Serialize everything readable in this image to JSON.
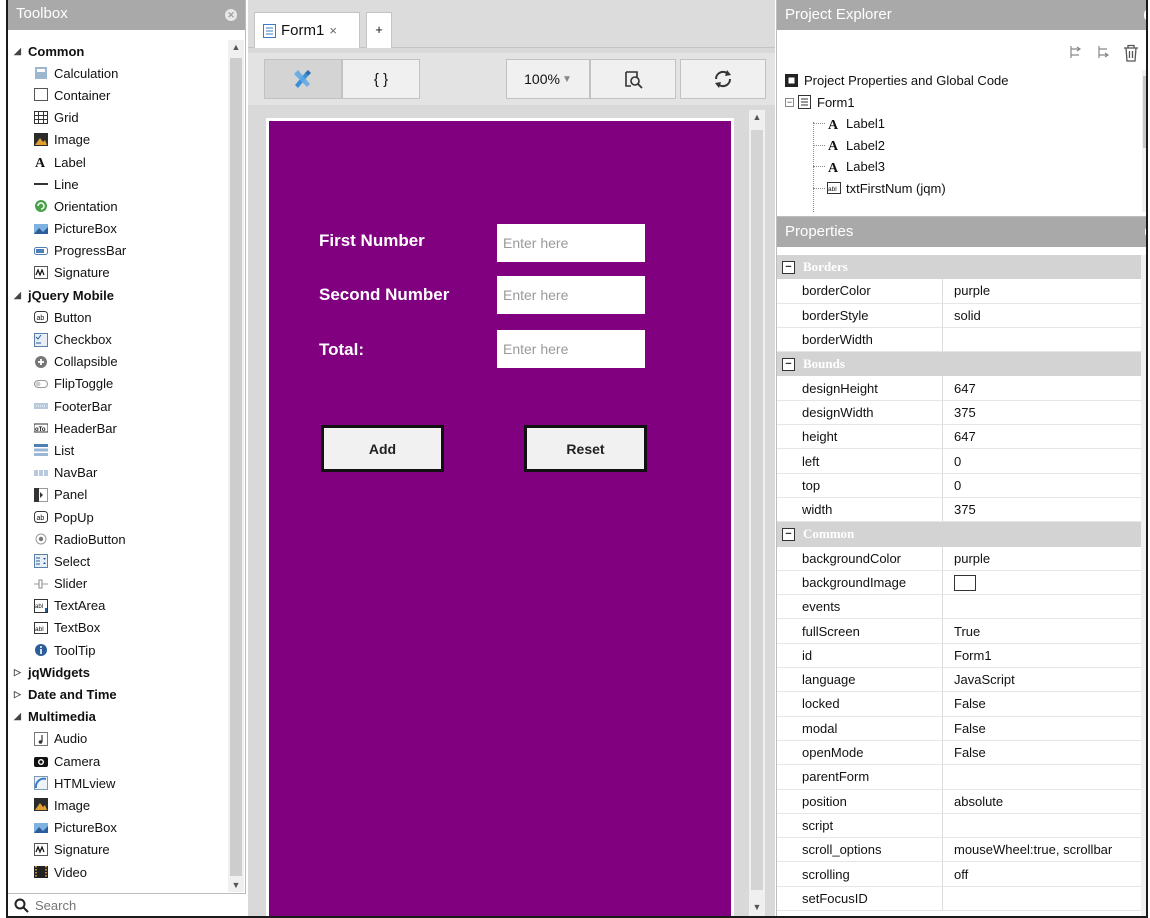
{
  "toolbox": {
    "title": "Toolbox",
    "search_placeholder": "Search",
    "items": [
      {
        "type": "group",
        "label": "Common",
        "expanded": true
      },
      {
        "type": "item",
        "label": "Calculation",
        "icon": "calculator-icon"
      },
      {
        "type": "item",
        "label": "Container",
        "icon": "container-icon"
      },
      {
        "type": "item",
        "label": "Grid",
        "icon": "grid-icon"
      },
      {
        "type": "item",
        "label": "Image",
        "icon": "image-icon"
      },
      {
        "type": "item",
        "label": "Label",
        "icon": "label-icon"
      },
      {
        "type": "item",
        "label": "Line",
        "icon": "line-icon"
      },
      {
        "type": "item",
        "label": "Orientation",
        "icon": "orientation-icon"
      },
      {
        "type": "item",
        "label": "PictureBox",
        "icon": "picturebox-icon"
      },
      {
        "type": "item",
        "label": "ProgressBar",
        "icon": "progressbar-icon"
      },
      {
        "type": "item",
        "label": "Signature",
        "icon": "signature-icon"
      },
      {
        "type": "group",
        "label": "jQuery Mobile",
        "expanded": true
      },
      {
        "type": "item",
        "label": "Button",
        "icon": "button-icon"
      },
      {
        "type": "item",
        "label": "Checkbox",
        "icon": "checkbox-icon"
      },
      {
        "type": "item",
        "label": "Collapsible",
        "icon": "collapsible-icon"
      },
      {
        "type": "item",
        "label": "FlipToggle",
        "icon": "fliptoggle-icon"
      },
      {
        "type": "item",
        "label": "FooterBar",
        "icon": "footerbar-icon"
      },
      {
        "type": "item",
        "label": "HeaderBar",
        "icon": "headerbar-icon"
      },
      {
        "type": "item",
        "label": "List",
        "icon": "list-icon"
      },
      {
        "type": "item",
        "label": "NavBar",
        "icon": "navbar-icon"
      },
      {
        "type": "item",
        "label": "Panel",
        "icon": "panel-icon"
      },
      {
        "type": "item",
        "label": "PopUp",
        "icon": "popup-icon"
      },
      {
        "type": "item",
        "label": "RadioButton",
        "icon": "radio-icon"
      },
      {
        "type": "item",
        "label": "Select",
        "icon": "select-icon"
      },
      {
        "type": "item",
        "label": "Slider",
        "icon": "slider-icon"
      },
      {
        "type": "item",
        "label": "TextArea",
        "icon": "textarea-icon"
      },
      {
        "type": "item",
        "label": "TextBox",
        "icon": "textbox-icon"
      },
      {
        "type": "item",
        "label": "ToolTip",
        "icon": "tooltip-icon"
      },
      {
        "type": "group",
        "label": "jqWidgets",
        "expanded": false
      },
      {
        "type": "group",
        "label": "Date and Time",
        "expanded": false
      },
      {
        "type": "group",
        "label": "Multimedia",
        "expanded": true
      },
      {
        "type": "item",
        "label": "Audio",
        "icon": "audio-icon"
      },
      {
        "type": "item",
        "label": "Camera",
        "icon": "camera-icon"
      },
      {
        "type": "item",
        "label": "HTMLview",
        "icon": "htmlview-icon"
      },
      {
        "type": "item",
        "label": "Image",
        "icon": "image-icon"
      },
      {
        "type": "item",
        "label": "PictureBox",
        "icon": "picturebox-icon"
      },
      {
        "type": "item",
        "label": "Signature",
        "icon": "signature-icon"
      },
      {
        "type": "item",
        "label": "Video",
        "icon": "video-icon"
      }
    ]
  },
  "editor": {
    "tab_label": "Form1",
    "tab_close": "×",
    "tab_add": "+",
    "code_button": "{ }",
    "zoom": "100%",
    "zoom_arrow": "▼"
  },
  "form": {
    "background": "#800080",
    "label_first": "First Number",
    "label_second": "Second Number",
    "label_total": "Total:",
    "input_placeholder": "Enter here",
    "button_add": "Add",
    "button_reset": "Reset"
  },
  "project_explorer": {
    "title": "Project Explorer",
    "tree": [
      {
        "level": 0,
        "label": "Project Properties and Global Code",
        "icon": "project-icon"
      },
      {
        "level": 0,
        "label": "Form1",
        "icon": "form-icon"
      },
      {
        "level": 1,
        "label": "Label1",
        "icon": "label-icon"
      },
      {
        "level": 1,
        "label": "Label2",
        "icon": "label-icon"
      },
      {
        "level": 1,
        "label": "Label3",
        "icon": "label-icon"
      },
      {
        "level": 1,
        "label": "txtFirstNum (jqm)",
        "icon": "textbox-icon"
      }
    ]
  },
  "properties": {
    "title": "Properties",
    "sections": [
      {
        "name": "Borders",
        "rows": [
          {
            "key": "borderColor",
            "value": "purple"
          },
          {
            "key": "borderStyle",
            "value": "solid"
          },
          {
            "key": "borderWidth",
            "value": ""
          }
        ]
      },
      {
        "name": "Bounds",
        "rows": [
          {
            "key": "designHeight",
            "value": "647"
          },
          {
            "key": "designWidth",
            "value": "375"
          },
          {
            "key": "height",
            "value": "647"
          },
          {
            "key": "left",
            "value": "0"
          },
          {
            "key": "top",
            "value": "0"
          },
          {
            "key": "width",
            "value": "375"
          }
        ]
      },
      {
        "name": "Common",
        "rows": [
          {
            "key": "backgroundColor",
            "value": "purple"
          },
          {
            "key": "backgroundImage",
            "value": "",
            "swatch": true
          },
          {
            "key": "events",
            "value": ""
          },
          {
            "key": "fullScreen",
            "value": "True"
          },
          {
            "key": "id",
            "value": "Form1"
          },
          {
            "key": "language",
            "value": "JavaScript"
          },
          {
            "key": "locked",
            "value": "False"
          },
          {
            "key": "modal",
            "value": "False"
          },
          {
            "key": "openMode",
            "value": "False"
          },
          {
            "key": "parentForm",
            "value": ""
          },
          {
            "key": "position",
            "value": "absolute"
          },
          {
            "key": "script",
            "value": ""
          },
          {
            "key": "scroll_options",
            "value": "mouseWheel:true, scrollbar"
          },
          {
            "key": "scrolling",
            "value": "off"
          },
          {
            "key": "setFocusID",
            "value": ""
          }
        ]
      }
    ]
  }
}
